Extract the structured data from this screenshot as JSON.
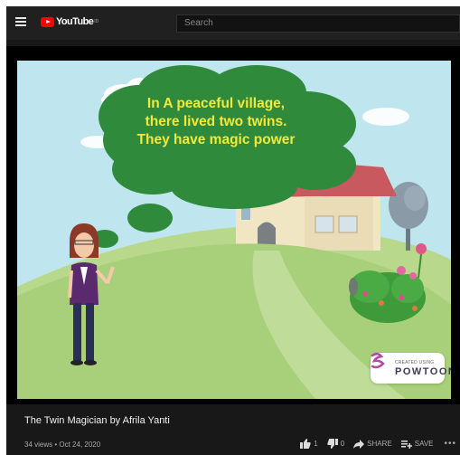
{
  "header": {
    "logo_text": "YouTube",
    "logo_region": "ID",
    "search_placeholder": "Search"
  },
  "video": {
    "bubble_line1": "In A peaceful village,",
    "bubble_line2": "there lived two twins.",
    "bubble_line3": "They have magic power",
    "watermark_small": "CREATED USING",
    "watermark_brand": "POWTOON"
  },
  "info": {
    "title": "The Twin Magician by Afrila Yanti",
    "meta": "34 views • Oct 24, 2020",
    "like_count": "1",
    "dislike_count": "0",
    "share_label": "SHARE",
    "save_label": "SAVE",
    "more_label": "•••"
  },
  "colors": {
    "brand_red": "#ff0000",
    "bubble_green": "#2f8a3c",
    "bubble_text": "#f4e83a",
    "sky": "#bfe6ef",
    "grass": "#a8cf7a"
  }
}
